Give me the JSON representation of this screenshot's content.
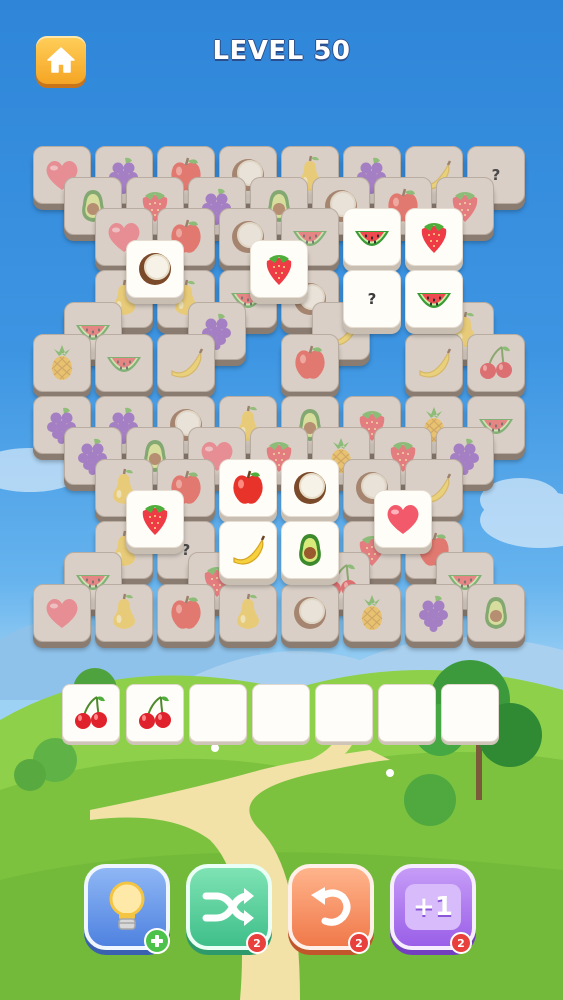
{
  "header": {
    "level_label": "LEVEL 50",
    "home_icon": "home-icon"
  },
  "colors": {
    "sky_top": "#2f86d9",
    "grass": "#7cc23f",
    "tile_free": "#fffdf8",
    "tile_blocked": "#d9cfc6",
    "badge": "#e8403c"
  },
  "board": {
    "hidden_label": "?",
    "tiles": [
      {
        "fruit": "heart",
        "state": "blocked"
      },
      {
        "fruit": "grapes",
        "state": "blocked"
      },
      {
        "fruit": "apple",
        "state": "blocked"
      },
      {
        "fruit": "coconut",
        "state": "blocked"
      },
      {
        "fruit": "pear",
        "state": "blocked"
      },
      {
        "fruit": "grapes",
        "state": "blocked"
      },
      {
        "fruit": "banana",
        "state": "blocked"
      },
      {
        "fruit": "hidden",
        "state": "blocked"
      },
      {
        "fruit": "avocado",
        "state": "blocked"
      },
      {
        "fruit": "strawberry",
        "state": "blocked"
      },
      {
        "fruit": "grapes",
        "state": "blocked"
      },
      {
        "fruit": "avocado",
        "state": "blocked"
      },
      {
        "fruit": "coconut",
        "state": "blocked"
      },
      {
        "fruit": "apple",
        "state": "blocked"
      },
      {
        "fruit": "strawberry",
        "state": "blocked"
      },
      {
        "fruit": "heart",
        "state": "blocked"
      },
      {
        "fruit": "apple",
        "state": "blocked"
      },
      {
        "fruit": "coconut",
        "state": "blocked"
      },
      {
        "fruit": "watermelon",
        "state": "blocked"
      },
      {
        "fruit": "coconut",
        "state": "free"
      },
      {
        "fruit": "strawberry",
        "state": "free"
      },
      {
        "fruit": "watermelon",
        "state": "free"
      },
      {
        "fruit": "strawberry",
        "state": "free"
      },
      {
        "fruit": "pear",
        "state": "blocked"
      },
      {
        "fruit": "pear",
        "state": "blocked"
      },
      {
        "fruit": "watermelon",
        "state": "blocked"
      },
      {
        "fruit": "coconut",
        "state": "blocked"
      },
      {
        "fruit": "hidden",
        "state": "free"
      },
      {
        "fruit": "watermelon",
        "state": "free"
      },
      {
        "fruit": "watermelon",
        "state": "blocked"
      },
      {
        "fruit": "grapes",
        "state": "blocked"
      },
      {
        "fruit": "banana",
        "state": "blocked"
      },
      {
        "fruit": "pear",
        "state": "blocked"
      },
      {
        "fruit": "pineapple",
        "state": "blocked"
      },
      {
        "fruit": "watermelon",
        "state": "blocked"
      },
      {
        "fruit": "banana",
        "state": "blocked"
      },
      {
        "fruit": "apple",
        "state": "blocked"
      },
      {
        "fruit": "banana",
        "state": "blocked"
      },
      {
        "fruit": "cherry",
        "state": "blocked"
      },
      {
        "fruit": "grapes",
        "state": "blocked"
      },
      {
        "fruit": "grapes",
        "state": "blocked"
      },
      {
        "fruit": "coconut",
        "state": "blocked"
      },
      {
        "fruit": "pear",
        "state": "blocked"
      },
      {
        "fruit": "avocado",
        "state": "blocked"
      },
      {
        "fruit": "strawberry",
        "state": "blocked"
      },
      {
        "fruit": "pineapple",
        "state": "blocked"
      },
      {
        "fruit": "watermelon",
        "state": "blocked"
      },
      {
        "fruit": "grapes",
        "state": "blocked"
      },
      {
        "fruit": "avocado",
        "state": "blocked"
      },
      {
        "fruit": "heart",
        "state": "blocked"
      },
      {
        "fruit": "strawberry",
        "state": "blocked"
      },
      {
        "fruit": "pineapple",
        "state": "blocked"
      },
      {
        "fruit": "strawberry",
        "state": "blocked"
      },
      {
        "fruit": "grapes",
        "state": "blocked"
      },
      {
        "fruit": "pear",
        "state": "blocked"
      },
      {
        "fruit": "apple",
        "state": "blocked"
      },
      {
        "fruit": "coconut",
        "state": "blocked"
      },
      {
        "fruit": "banana",
        "state": "blocked"
      },
      {
        "fruit": "apple",
        "state": "free"
      },
      {
        "fruit": "coconut",
        "state": "free"
      },
      {
        "fruit": "strawberry",
        "state": "free"
      },
      {
        "fruit": "heart",
        "state": "free"
      },
      {
        "fruit": "pear",
        "state": "blocked"
      },
      {
        "fruit": "hidden",
        "state": "blocked"
      },
      {
        "fruit": "strawberry",
        "state": "blocked"
      },
      {
        "fruit": "apple",
        "state": "blocked"
      },
      {
        "fruit": "banana",
        "state": "free"
      },
      {
        "fruit": "avocado",
        "state": "free"
      },
      {
        "fruit": "watermelon",
        "state": "blocked"
      },
      {
        "fruit": "cherry",
        "state": "blocked"
      },
      {
        "fruit": "strawberry",
        "state": "blocked"
      },
      {
        "fruit": "watermelon",
        "state": "blocked"
      },
      {
        "fruit": "heart",
        "state": "blocked"
      },
      {
        "fruit": "pear",
        "state": "blocked"
      },
      {
        "fruit": "apple",
        "state": "blocked"
      },
      {
        "fruit": "pear",
        "state": "blocked"
      },
      {
        "fruit": "coconut",
        "state": "blocked"
      },
      {
        "fruit": "pineapple",
        "state": "blocked"
      },
      {
        "fruit": "grapes",
        "state": "blocked"
      },
      {
        "fruit": "avocado",
        "state": "blocked"
      }
    ]
  },
  "tray": {
    "slots": [
      "cherry",
      "cherry",
      "",
      "",
      "",
      "",
      ""
    ]
  },
  "boosters": [
    {
      "name": "hint",
      "icon": "lightbulb-icon",
      "badge": "+"
    },
    {
      "name": "shuffle",
      "icon": "shuffle-icon",
      "badge": "2"
    },
    {
      "name": "undo",
      "icon": "undo-icon",
      "badge": "2"
    },
    {
      "name": "extra-slot",
      "icon": "plus-one-icon",
      "label": "+1",
      "badge": "2"
    }
  ]
}
